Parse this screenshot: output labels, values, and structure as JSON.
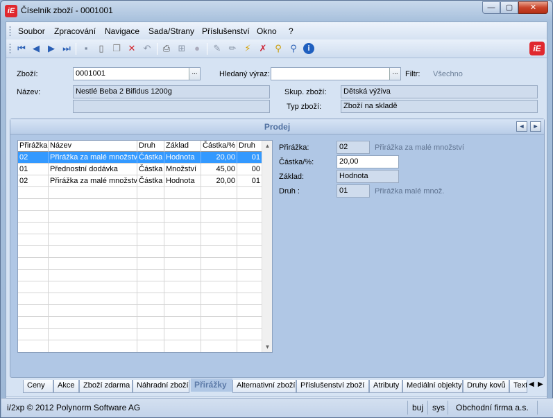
{
  "window": {
    "logo": "iE",
    "title": "Číselník zboží - 0001001",
    "minimize": "—",
    "maximize": "▢",
    "close": "✕"
  },
  "menu": [
    "Soubor",
    "Zpracování",
    "Navigace",
    "Sada/Strany",
    "Příslušenství",
    "Okno",
    "?"
  ],
  "toolbar": {
    "icons": [
      "first-icon",
      "prev-icon",
      "next-icon",
      "last-icon",
      "save-icon",
      "new-icon",
      "copy-icon",
      "delete-icon",
      "undo-icon",
      "print-icon",
      "tree-icon",
      "disabled-icon",
      "edit-icon",
      "edit2-icon",
      "filter-icon",
      "filter-clear-icon",
      "search-icon",
      "find-icon",
      "info-icon"
    ],
    "brand": "iE"
  },
  "form": {
    "zbozi_label": "Zboží:",
    "zbozi_value": "0001001",
    "hledany_label": "Hledaný výraz:",
    "hledany_value": "",
    "filtr_label": "Filtr:",
    "filtr_value": "Všechno",
    "nazev_label": "Název:",
    "nazev_value": "Nestlé Beba 2 Bifidus 1200g",
    "nazev_value2": "",
    "skup_label": "Skup. zboží:",
    "skup_value": "Dětská výživa",
    "typ_label": "Typ zboží:",
    "typ_value": "Zboží na skladě",
    "ellipsis": "..."
  },
  "panel": {
    "title": "Prodej",
    "prev": "◄",
    "next": "►"
  },
  "grid": {
    "columns": [
      "Přirážka",
      "Název",
      "Druh",
      "Základ",
      "Částka/%",
      "Druh"
    ],
    "rows": [
      [
        "02",
        "Přirážka za malé množství",
        "Částka",
        "Hodnota",
        "20,00",
        "01"
      ],
      [
        "01",
        "Přednostní dodávka",
        "Částka",
        "Množství",
        "45,00",
        "00"
      ],
      [
        "02",
        "Přirážka za malé množství",
        "Částka",
        "Hodnota",
        "20,00",
        "01"
      ]
    ]
  },
  "detail": {
    "prirazka_label": "Přirážka:",
    "prirazka_value": "02",
    "prirazka_desc": "Přirážka za malé množství",
    "castka_label": "Částka/%:",
    "castka_value": "20,00",
    "zaklad_label": "Základ:",
    "zaklad_value": "Hodnota",
    "druh_label": "Druh   :",
    "druh_value": "01",
    "druh_desc": "Přirážka malé množ."
  },
  "tabs": [
    "Ceny",
    "Akce",
    "Zboží zdarma",
    "Náhradní zboží",
    "Přirážky",
    "Alternativní zboží",
    "Příslušenství zboží",
    "Atributy",
    "Mediální objekty",
    "Druhy kovů",
    "Text"
  ],
  "status": {
    "copyright": "i/2xp © 2012 Polynorm Software AG",
    "user": "buj",
    "role": "sys",
    "company": "Obchodní firma a.s."
  }
}
